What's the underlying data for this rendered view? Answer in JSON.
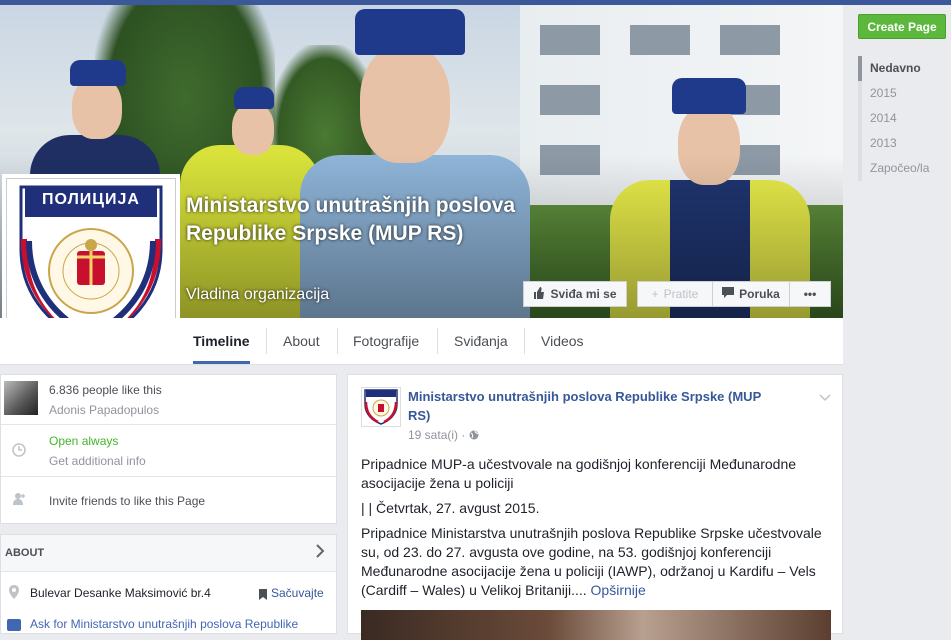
{
  "right_rail": {
    "create_page": "Create Page",
    "years": [
      "Nedavno",
      "2015",
      "2014",
      "2013",
      "Započeo/la"
    ]
  },
  "cover": {
    "page_name": "Ministarstvo unutrašnjih poslova Republike Srpske (MUP RS)",
    "category": "Vladina organizacija",
    "badge_text": "ПОЛИЦИЈА",
    "buttons": {
      "like": "Sviđa mi se",
      "follow": "Pratite",
      "message": "Poruka",
      "more": "•••"
    }
  },
  "tabs": [
    "Timeline",
    "About",
    "Fotografije",
    "Sviđanja",
    "Videos"
  ],
  "left": {
    "likes_count": "6.836 people like this",
    "liker_name": "Adonis Papadopulos",
    "open_status": "Open always",
    "get_info": "Get additional info",
    "invite": "Invite friends to like this Page",
    "about_header": "ABOUT",
    "address": "Bulevar Desanke Maksimović br.4",
    "save": "Sačuvajte",
    "ask": "Ask for Ministarstvo unutrašnjih poslova Republike"
  },
  "post": {
    "author": "Ministarstvo unutrašnjih poslova Republike Srpske (MUP RS)",
    "time": "19 sata(i) · ",
    "headline": "Pripadnice MUP-a učestvovale na godišnjoj konferenciji Međunarodne asocijacije žena u policiji",
    "date_line": "| | Četvrtak, 27. avgust 2015.",
    "body": "Pripadnice Ministarstva unutrašnjih poslova Republike Srpske učestvovale su, od 23. do 27. avgusta ove godine, na 53. godišnjoj konferenciji Međunarodne asocijacije žena u policiji (IAWP), održanoj u Kardifu – Vels (Cardiff – Wales) u Velikoj Britaniji.... ",
    "see_more": "Opširnije"
  },
  "colors": {
    "facebook_blue": "#3b5998",
    "link": "#4267b2",
    "green": "#42b72a",
    "create_green": "#5cb83c"
  }
}
